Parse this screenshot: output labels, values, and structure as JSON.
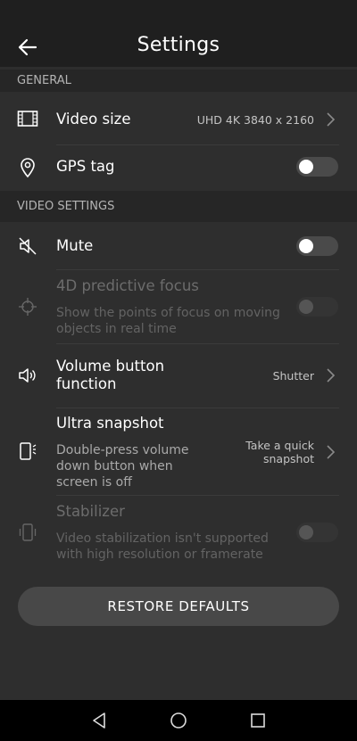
{
  "header": {
    "title": "Settings"
  },
  "sections": {
    "general": "GENERAL",
    "video": "VIDEO SETTINGS"
  },
  "items": {
    "video_size": {
      "label": "Video size",
      "value": "UHD 4K 3840 x 2160"
    },
    "gps_tag": {
      "label": "GPS tag",
      "enabled": false
    },
    "mute": {
      "label": "Mute",
      "enabled": false
    },
    "predictive_focus": {
      "label": "4D predictive focus",
      "description_line1": "Show the points of focus on moving",
      "description_line2": "objects in real time",
      "enabled": false
    },
    "volume_button": {
      "label_line1": "Volume button",
      "label_line2": "function",
      "value": "Shutter"
    },
    "ultra_snapshot": {
      "label": "Ultra snapshot",
      "description_line1": "Double-press volume",
      "description_line2": "down button when",
      "description_line3": "screen is off",
      "value_line1": "Take a quick",
      "value_line2": "snapshot"
    },
    "stabilizer": {
      "label": "Stabilizer",
      "description_line1": "Video stabilization isn't supported",
      "description_line2": "with high resolution or framerate",
      "enabled": false
    }
  },
  "restore_button": "RESTORE DEFAULTS",
  "colors": {
    "background": "#2e2e2e",
    "header": "#1f1f1f",
    "section": "#262626",
    "button": "#484848"
  }
}
